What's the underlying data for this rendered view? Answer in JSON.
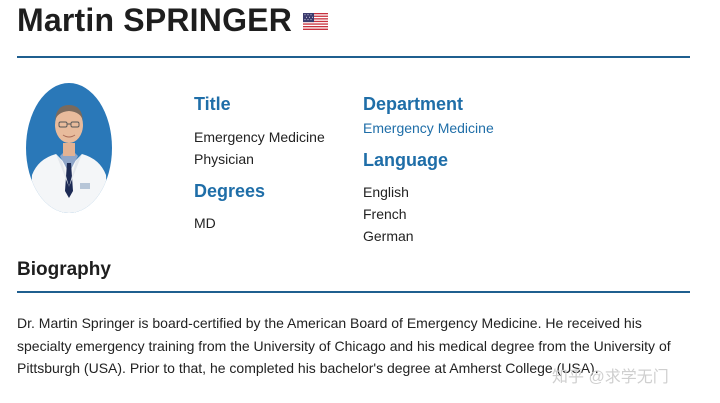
{
  "profile": {
    "name": "Martin SPRINGER",
    "flag_icon": "us-flag-icon"
  },
  "info": {
    "title_heading": "Title",
    "title_lines": [
      "Emergency Medicine",
      "Physician"
    ],
    "degrees_heading": "Degrees",
    "degrees": [
      "MD"
    ],
    "department_heading": "Department",
    "department_value": "Emergency Medicine",
    "language_heading": "Language",
    "languages": [
      "English",
      "French",
      "German"
    ]
  },
  "biography": {
    "heading": "Biography",
    "text": "Dr. Martin Springer is board-certified by the American Board of Emergency Medicine. He received his specialty emergency training from the University of Chicago and his medical degree from the University of Pittsburgh (USA). Prior to that, he completed his bachelor's degree at Amherst College (USA)."
  },
  "watermark": "知乎 @求学无门",
  "colors": {
    "accent": "#1f6ea8",
    "rule": "#1f5f8f",
    "heading_dark": "#1e1e1e",
    "avatar_bg": "#2a78b8"
  }
}
